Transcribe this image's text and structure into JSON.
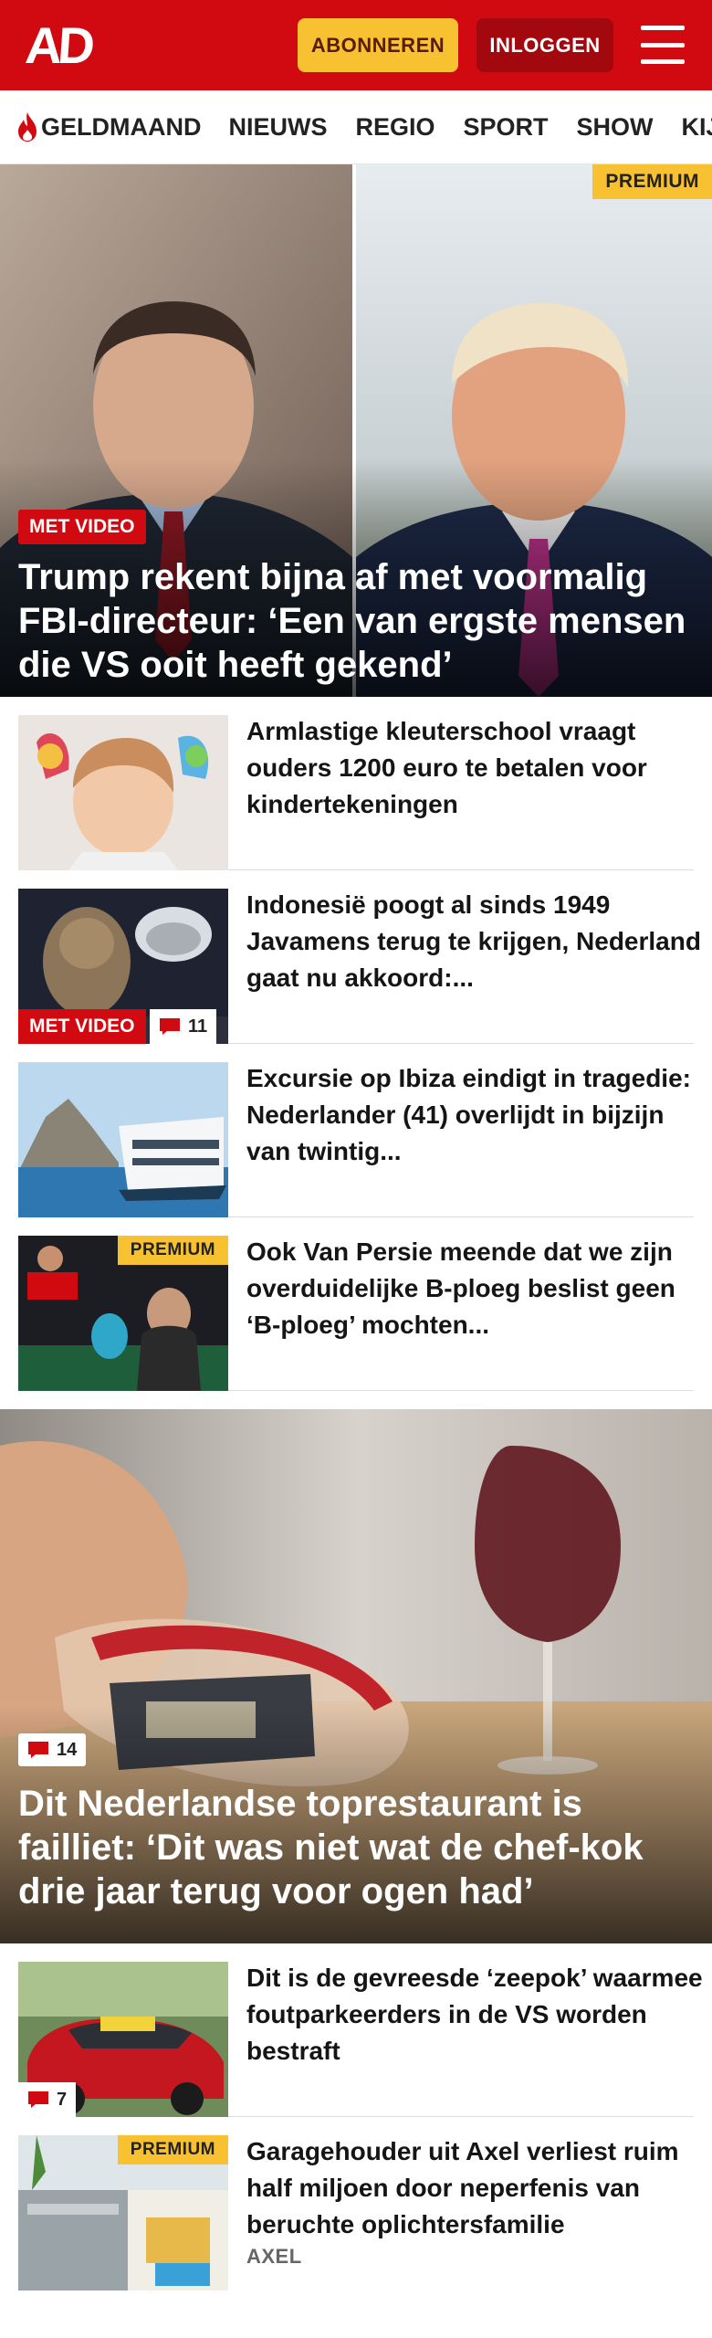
{
  "header": {
    "logo": "AD",
    "subscribe_label": "ABONNEREN",
    "login_label": "INLOGGEN"
  },
  "nav": {
    "items": [
      {
        "label": "GELDMAAND",
        "icon": "flame-icon"
      },
      {
        "label": "NIEUWS"
      },
      {
        "label": "REGIO"
      },
      {
        "label": "SPORT"
      },
      {
        "label": "SHOW"
      },
      {
        "label": "KIJK"
      }
    ]
  },
  "hero1": {
    "badge": "MET VIDEO",
    "premium": "PREMIUM",
    "title": "Trump rekent bijna af met voormalig FBI-directeur: ‘Een van ergste mensen die VS ooit heeft gekend’"
  },
  "articles1": [
    {
      "title": "Armlastige kleuterschool vraagt ouders 1200 euro te betalen voor kindertekeningen"
    },
    {
      "title": "Indonesië poogt al sinds 1949 Javamens terug te krijgen, Nederland gaat nu akkoord:...",
      "badge": "MET VIDEO",
      "comments": "11"
    },
    {
      "title": "Excursie op Ibiza eindigt in tragedie: Nederlander (41) overlijdt in bijzijn van twintig..."
    },
    {
      "title": "Ook Van Persie meende dat we zijn overduidelijke B-ploeg beslist geen ‘B-ploeg’ mochten...",
      "premium": "PREMIUM"
    }
  ],
  "hero2": {
    "comments": "14",
    "title": "Dit Nederlandse toprestaurant is failliet: ‘Dit was niet wat de chef-kok drie jaar terug voor ogen had’"
  },
  "articles2": [
    {
      "title": "Dit is de gevreesde ‘zeepok’ waarmee foutparkeerders in de VS worden bestraft",
      "comments": "7"
    },
    {
      "title": "Garagehouder uit Axel verliest ruim half miljoen door neperfenis van beruchte oplichtersfamilie",
      "premium": "PREMIUM",
      "location": "AXEL"
    }
  ],
  "colors": {
    "brand_red": "#d10a11",
    "premium_yellow": "#f7c132",
    "login_red": "#a3080e"
  }
}
